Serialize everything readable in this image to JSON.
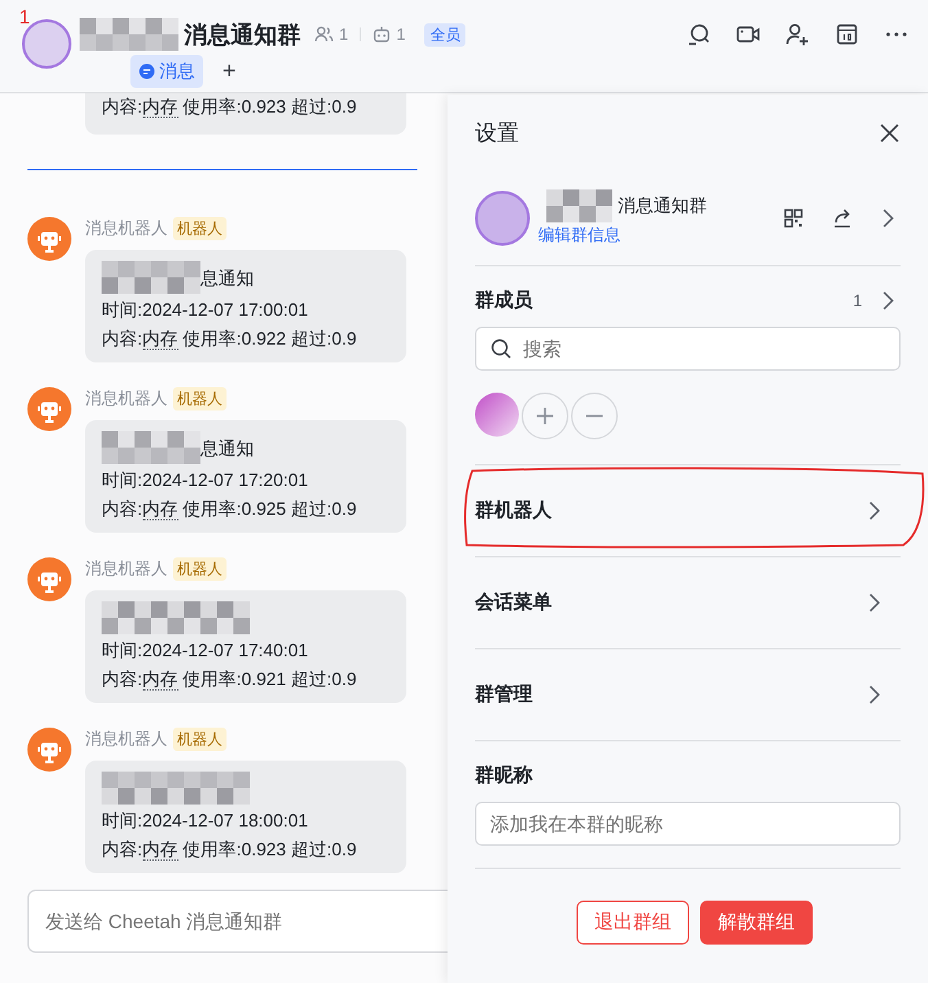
{
  "annotation": "1",
  "header": {
    "title": "消息通知群",
    "member_count": "1",
    "bot_count": "1",
    "tag": "全员",
    "tabs": [
      {
        "label": "消息",
        "selected": true
      }
    ],
    "add_tab": "+"
  },
  "chat": {
    "partial_message": {
      "label": "内容:",
      "keyword": "内存",
      "text": " 使用率:0.923 超过:0.9"
    },
    "messages": [
      {
        "sender": "消息机器人",
        "tag": "机器人",
        "title_fragment": "息通知",
        "time": "时间:2024-12-07 17:00:01",
        "content": {
          "label": "内容:",
          "keyword": "内存",
          "text": " 使用率:0.922 超过:0.9"
        }
      },
      {
        "sender": "消息机器人",
        "tag": "机器人",
        "title_fragment": "息通知",
        "time": "时间:2024-12-07 17:20:01",
        "content": {
          "label": "内容:",
          "keyword": "内存",
          "text": " 使用率:0.925 超过:0.9"
        }
      },
      {
        "sender": "消息机器人",
        "tag": "机器人",
        "time": "时间:2024-12-07 17:40:01",
        "content": {
          "label": "内容:",
          "keyword": "内存",
          "text": " 使用率:0.921 超过:0.9"
        }
      },
      {
        "sender": "消息机器人",
        "tag": "机器人",
        "time": "时间:2024-12-07 18:00:01",
        "content": {
          "label": "内容:",
          "keyword": "内存",
          "text": " 使用率:0.923 超过:0.9"
        }
      }
    ],
    "composer": {
      "placeholder": "发送给 Cheetah 消息通知群"
    }
  },
  "settings": {
    "title": "设置",
    "group_name": "消息通知群",
    "edit_link": "编辑群信息",
    "members": {
      "label": "群成员",
      "count": "1",
      "search_placeholder": "搜索"
    },
    "rows": [
      {
        "label": "群机器人",
        "highlighted": true
      },
      {
        "label": "会话菜单",
        "highlighted": false
      },
      {
        "label": "群管理",
        "highlighted": false
      }
    ],
    "nickname": {
      "label": "群昵称",
      "placeholder": "添加我在本群的昵称"
    },
    "buttons": [
      {
        "label": "退出群组",
        "kind": "outline"
      },
      {
        "label": "解散群组",
        "kind": "danger"
      }
    ]
  }
}
